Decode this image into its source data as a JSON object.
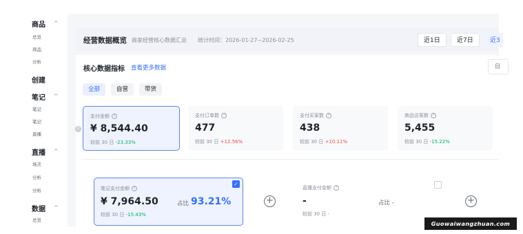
{
  "sidebar": {
    "sections": [
      {
        "title": "商品",
        "chevron": "^",
        "items": [
          "总览",
          "商品",
          "分析"
        ]
      },
      {
        "title": "创建",
        "items": []
      },
      {
        "title": "笔记",
        "chevron": "^",
        "items": [
          "笔记",
          "笔记",
          "直播"
        ]
      },
      {
        "title": "直播",
        "chevron": "^",
        "items": [
          "场次",
          "分析",
          "分析"
        ]
      },
      {
        "title": "数据",
        "chevron": "^",
        "items": [
          "总览"
        ]
      }
    ]
  },
  "header": {
    "title": "经营数据概览",
    "subtitle": "商家经营核心数据汇总",
    "period": "统计时间：2026-01-27~2026-02-25",
    "ranges": [
      {
        "label": "近1日",
        "active": false
      },
      {
        "label": "近7日",
        "active": false
      },
      {
        "label": "近3",
        "active": true
      }
    ]
  },
  "core": {
    "title": "核心数据指标",
    "link": "查看更多数据",
    "corner_label": "日",
    "tabs": [
      {
        "label": "全部",
        "active": true
      },
      {
        "label": "自营",
        "active": false
      },
      {
        "label": "带货",
        "active": false
      }
    ],
    "left_dot": "0",
    "cards": [
      {
        "label": "支付金额",
        "value": "¥ 8,544.40",
        "cmp_prefix": "较前 30 日",
        "change": "-23.33%",
        "trend": "down",
        "selected": true
      },
      {
        "label": "支付订单数",
        "value": "477",
        "cmp_prefix": "较前 30 日",
        "change": "+12.56%",
        "trend": "up",
        "selected": false
      },
      {
        "label": "支付买家数",
        "value": "438",
        "cmp_prefix": "较前 30 日",
        "change": "+10.11%",
        "trend": "up",
        "selected": false
      },
      {
        "label": "商品访客数",
        "value": "5,455",
        "cmp_prefix": "较前 30 日",
        "change": "-15.22%",
        "trend": "down",
        "selected": false
      }
    ]
  },
  "breakdown": {
    "note_card": {
      "label": "笔记支付金额",
      "value": "¥ 7,964.50",
      "cmp_prefix": "较前 30 日",
      "change": "-15.43%",
      "share_label": "占比",
      "share_value": "93.21%",
      "checked": true
    },
    "live_card": {
      "label": "直播支付金额",
      "value": "-",
      "cmp": "较前 30 日 -",
      "share_label": "占比 -",
      "checked": false
    },
    "plus_symbol": "+"
  },
  "watermark": "Guowaiwangzhuan.com",
  "colors": {
    "accent": "#3470ff",
    "up": "#f54a45",
    "down": "#00b365"
  }
}
